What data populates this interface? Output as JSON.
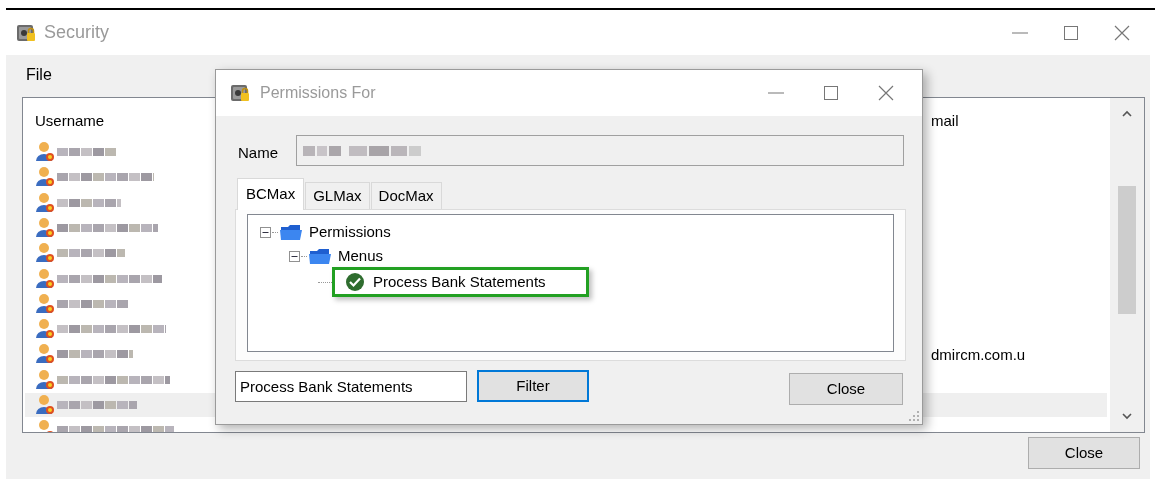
{
  "window": {
    "title": "Security",
    "menu": [
      "File"
    ],
    "list": {
      "columns": [
        {
          "label": "Username"
        },
        {
          "label": "mail"
        }
      ],
      "rows": [
        {
          "selected": false
        },
        {
          "selected": false
        },
        {
          "selected": false
        },
        {
          "selected": false
        },
        {
          "selected": false
        },
        {
          "selected": false
        },
        {
          "selected": false
        },
        {
          "selected": false
        },
        {
          "selected": false,
          "email": "dmircm.com.u"
        },
        {
          "selected": false
        },
        {
          "selected": true
        },
        {
          "selected": false
        }
      ]
    },
    "close_button": "Close"
  },
  "dialog": {
    "title": "Permissions For",
    "name_label": "Name",
    "tabs": [
      {
        "label": "BCMax",
        "selected": true
      },
      {
        "label": "GLMax",
        "selected": false
      },
      {
        "label": "DocMax",
        "selected": false
      }
    ],
    "tree": [
      {
        "label": "Permissions",
        "kind": "folder",
        "expanded": true,
        "children": [
          {
            "label": "Menus",
            "kind": "folder",
            "expanded": true,
            "children": [
              {
                "label": "Process Bank Statements",
                "kind": "permission",
                "checked": true,
                "highlighted": true
              }
            ]
          }
        ]
      }
    ],
    "filter": {
      "value": "Process Bank Statements"
    },
    "filter_button": {
      "label": "Filter",
      "focused": true
    },
    "close_button": "Close"
  }
}
